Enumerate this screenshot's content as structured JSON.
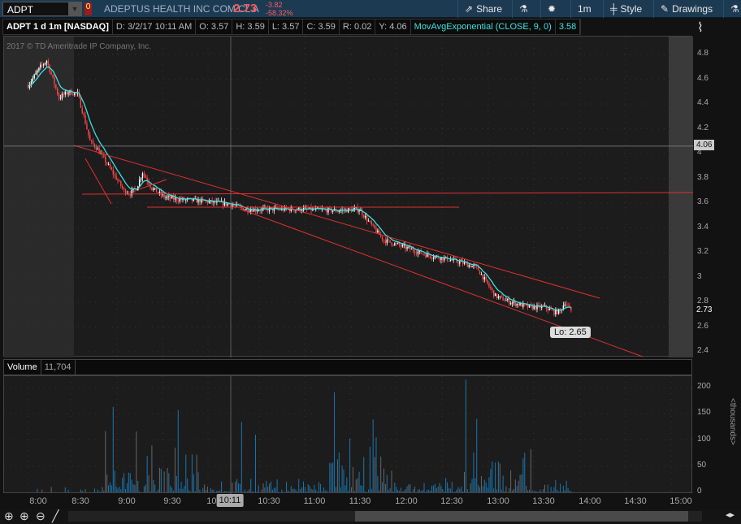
{
  "header": {
    "symbol": "ADPT",
    "flag": "0",
    "company": "ADEPTUS HEALTH INC COM CL A",
    "last": "2.73",
    "change": "-3.82",
    "change_pct": "-58.32%",
    "share": "Share",
    "timeframe": "1m",
    "style": "Style",
    "drawings": "Drawings"
  },
  "info": {
    "title": "ADPT 1 d 1m [NASDAQ]",
    "date": "D: 3/2/17 10:11 AM",
    "open": "O: 3.57",
    "high": "H: 3.59",
    "low": "L: 3.57",
    "close": "C: 3.59",
    "range": "R: 0.02",
    "prev": "Y: 4.06",
    "study": "MovAvgExponential (CLOSE, 9, 0)",
    "study_value": "3.58"
  },
  "copyright": "2017 © TD Ameritrade IP Company, Inc.",
  "price_labels": [
    "4.8",
    "4.6",
    "4.4",
    "4.2",
    "4",
    "3.8",
    "3.6",
    "3.4",
    "3.2",
    "3",
    "2.8",
    "2.6",
    "2.4"
  ],
  "markers": {
    "prev_close": "4.06",
    "last": "2.73",
    "low_bubble": "Lo: 2.65",
    "crosshair_time": "10:11"
  },
  "volume": {
    "label": "Volume",
    "value": "11,704",
    "axis_labels": [
      "200",
      "150",
      "100",
      "50",
      "0"
    ],
    "unit": "<thousands>"
  },
  "time_labels": [
    "8:00",
    "8:30",
    "9:00",
    "9:30",
    "10:00",
    "10:30",
    "11:00",
    "11:30",
    "12:00",
    "12:30",
    "13:00",
    "13:30",
    "14:00",
    "14:30",
    "15:00"
  ],
  "colors": {
    "up": "#ffffff",
    "down": "#ff4444",
    "ema": "#3ee0e0",
    "volume": "#1a76b0",
    "drawing": "#e03030"
  },
  "chart_data": {
    "type": "candlestick",
    "price_range": [
      2.35,
      4.9
    ],
    "close_keypoints": [
      [
        0,
        4.55
      ],
      [
        8,
        4.7
      ],
      [
        12,
        4.75
      ],
      [
        16,
        4.6
      ],
      [
        20,
        4.45
      ],
      [
        26,
        4.5
      ],
      [
        32,
        4.48
      ],
      [
        36,
        4.3
      ],
      [
        40,
        4.1
      ],
      [
        44,
        4.05
      ],
      [
        52,
        3.9
      ],
      [
        58,
        3.78
      ],
      [
        62,
        3.7
      ],
      [
        66,
        3.68
      ],
      [
        70,
        3.72
      ],
      [
        74,
        3.85
      ],
      [
        80,
        3.72
      ],
      [
        88,
        3.65
      ],
      [
        96,
        3.63
      ],
      [
        110,
        3.62
      ],
      [
        131,
        3.59
      ],
      [
        140,
        3.55
      ],
      [
        160,
        3.55
      ],
      [
        180,
        3.55
      ],
      [
        200,
        3.54
      ],
      [
        214,
        3.55
      ],
      [
        222,
        3.42
      ],
      [
        230,
        3.3
      ],
      [
        242,
        3.25
      ],
      [
        258,
        3.18
      ],
      [
        270,
        3.15
      ],
      [
        280,
        3.12
      ],
      [
        290,
        3.08
      ],
      [
        302,
        2.85
      ],
      [
        312,
        2.8
      ],
      [
        324,
        2.76
      ],
      [
        334,
        2.76
      ],
      [
        340,
        2.72
      ],
      [
        344,
        2.73
      ],
      [
        347,
        2.8
      ],
      [
        351,
        2.73
      ]
    ],
    "volume_spikes_k": [
      [
        50,
        117
      ],
      [
        55,
        163
      ],
      [
        70,
        116
      ],
      [
        97,
        157
      ],
      [
        138,
        134
      ],
      [
        147,
        110
      ],
      [
        198,
        191
      ],
      [
        208,
        103
      ],
      [
        223,
        139
      ],
      [
        225,
        105
      ],
      [
        283,
        215
      ],
      [
        290,
        140
      ],
      [
        320,
        65
      ]
    ]
  }
}
